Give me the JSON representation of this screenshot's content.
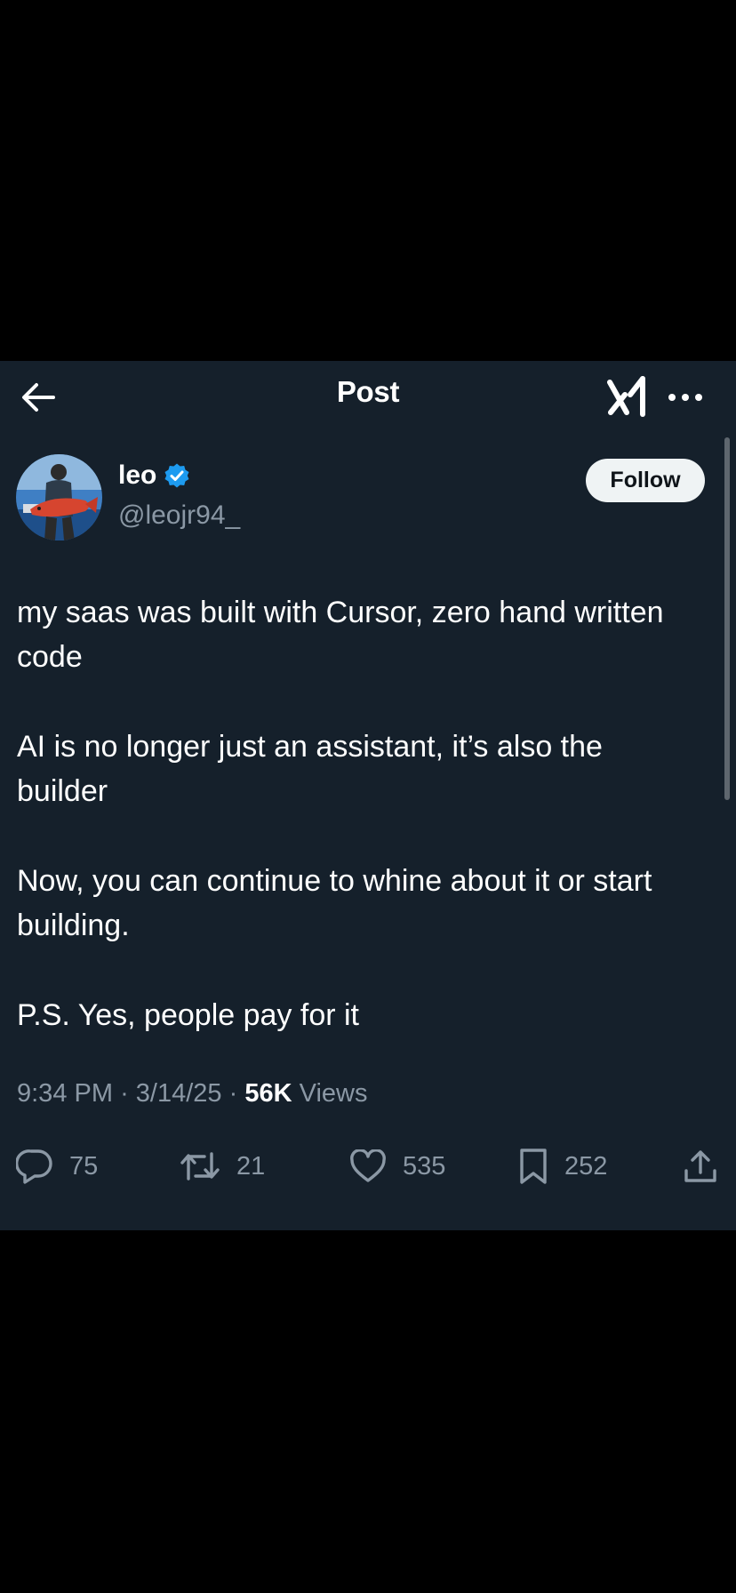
{
  "header": {
    "title": "Post",
    "back_icon": "arrow-left-icon",
    "grok_icon": "grok-logo-icon",
    "more_icon": "more-horizontal-icon"
  },
  "author": {
    "name": "leo",
    "handle": "@leojr94_",
    "verified": true,
    "verified_color": "#1d9bf0",
    "avatar": "profile-photo-person-holding-red-fish"
  },
  "follow_button": {
    "label": "Follow"
  },
  "post": {
    "paragraphs": [
      "my saas was built with Cursor, zero hand written code",
      "AI is no longer just an assistant, it’s also the builder",
      "Now, you can continue to whine about it or start building.",
      "P.S. Yes, people pay for it"
    ],
    "time": "9:34 PM",
    "separator": "·",
    "date": "3/14/25",
    "views_count": "56K",
    "views_label": "Views"
  },
  "actions": {
    "replies": "75",
    "reposts": "21",
    "likes": "535",
    "bookmarks": "252"
  },
  "colors": {
    "background": "#15202b",
    "outer_background": "#000000",
    "text_primary": "#ffffff",
    "text_secondary": "#8b98a5",
    "accent": "#1d9bf0"
  }
}
